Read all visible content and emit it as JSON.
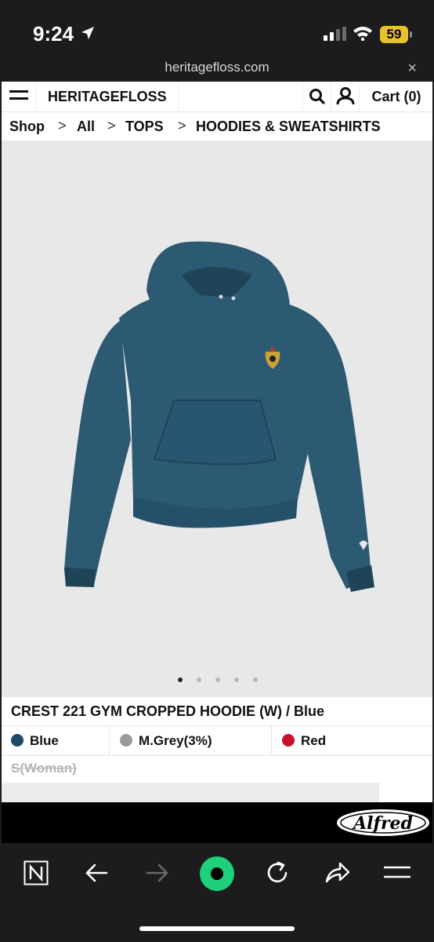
{
  "status": {
    "time": "9:24",
    "battery": "59"
  },
  "browser": {
    "url": "heritagefloss.com",
    "close_symbol": "×"
  },
  "site": {
    "brand": "HERITAGEFLOSS",
    "cart": "Cart (0)",
    "breadcrumb": {
      "items": [
        "Shop",
        "All",
        "TOPS",
        "HOODIES & SWEATSHIRTS"
      ],
      "separator": ">"
    }
  },
  "product": {
    "title": "CREST 221 GYM CROPPED HOODIE (W) / Blue",
    "image_count": 5,
    "active_image": 1,
    "colors": [
      {
        "label": "Blue",
        "swatch": "#1e4a66"
      },
      {
        "label": "M.Grey(3%)",
        "swatch": "#9a9a9a"
      },
      {
        "label": "Red",
        "swatch": "#c8102e"
      }
    ],
    "size": "S(Woman)"
  },
  "banner": {
    "logo_text": "Alfred"
  },
  "accent": {
    "hoodie": "#2b5a72",
    "hoodie_dark": "#1f4457"
  }
}
